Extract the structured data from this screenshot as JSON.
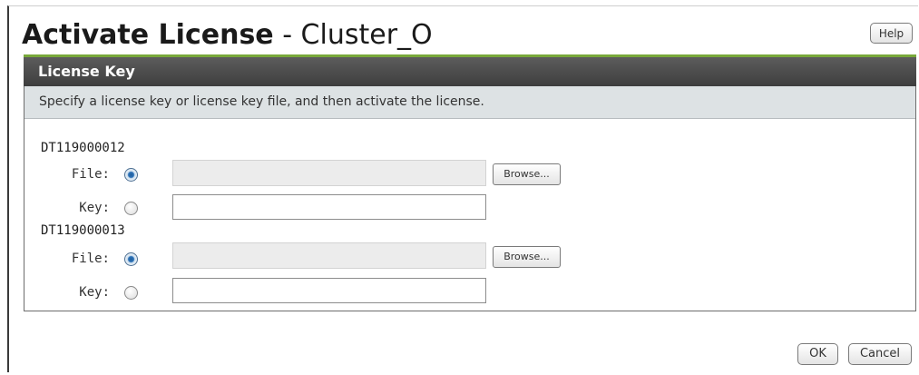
{
  "dialog": {
    "title_bold": "Activate License",
    "title_rest": " - Cluster_O",
    "help_label": "Help"
  },
  "panel": {
    "header": "License Key",
    "description": "Specify a license key or license key file, and then activate the license."
  },
  "devices": [
    {
      "id": "DT119000012",
      "file_label": "File:",
      "key_label": "Key:",
      "file_value": "",
      "key_value": "",
      "browse_label": "Browse...",
      "selected": "file"
    },
    {
      "id": "DT119000013",
      "file_label": "File:",
      "key_label": "Key:",
      "file_value": "",
      "key_value": "",
      "browse_label": "Browse...",
      "selected": "file"
    }
  ],
  "footer": {
    "ok_label": "OK",
    "cancel_label": "Cancel"
  },
  "colors": {
    "header_bg": "#4a4a4a",
    "accent_green": "#78a83a",
    "description_bg": "#dde2e4",
    "radio_selected": "#2d72b8"
  }
}
